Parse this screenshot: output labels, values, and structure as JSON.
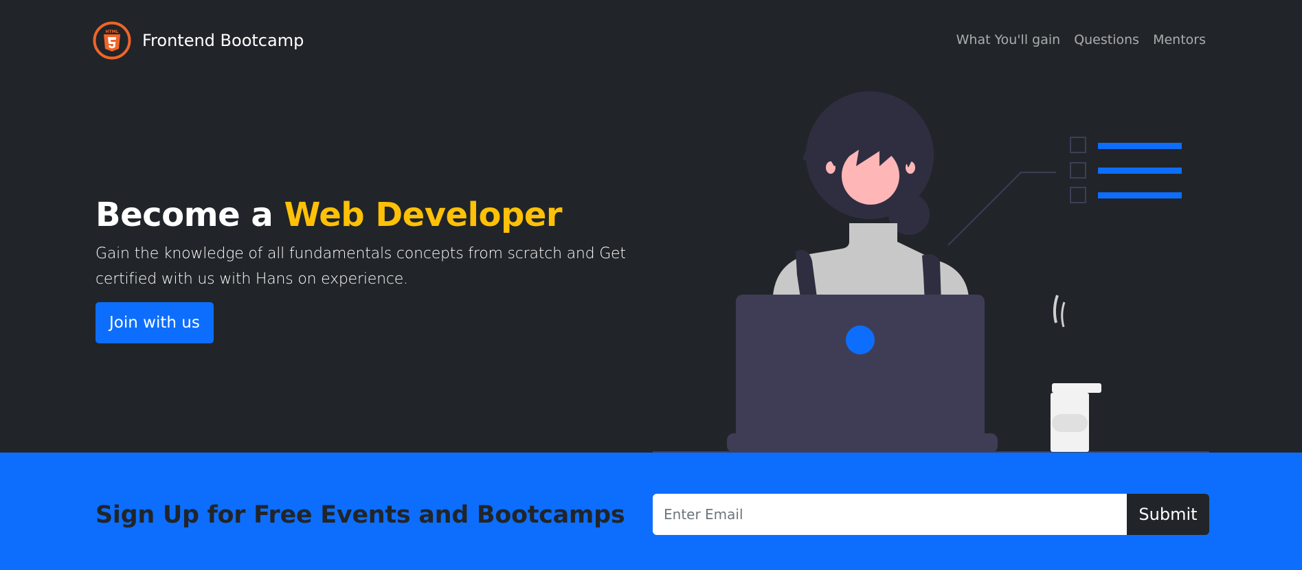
{
  "navbar": {
    "brand_text": "Frontend Bootcamp",
    "logo_icon": "html5-logo-icon",
    "links": [
      "What You'll gain",
      "Questions",
      "Mentors"
    ]
  },
  "hero": {
    "title_plain": "Become a ",
    "title_accent": "Web Developer",
    "lead": "Gain the knowledge of all fundamentals concepts from scratch and Get certified with us with Hans on experience.",
    "button_label": "Join with us"
  },
  "illustration": {
    "name": "woman-working-on-laptop-illustration"
  },
  "signup": {
    "title": "Sign Up for Free Events and Bootcamps",
    "email_placeholder": "Enter Email",
    "email_value": "",
    "submit_label": "Submit"
  },
  "colors": {
    "background_dark": "#212529",
    "primary_blue": "#0d6efd",
    "accent_yellow": "#ffc107",
    "logo_orange": "#f06529"
  }
}
